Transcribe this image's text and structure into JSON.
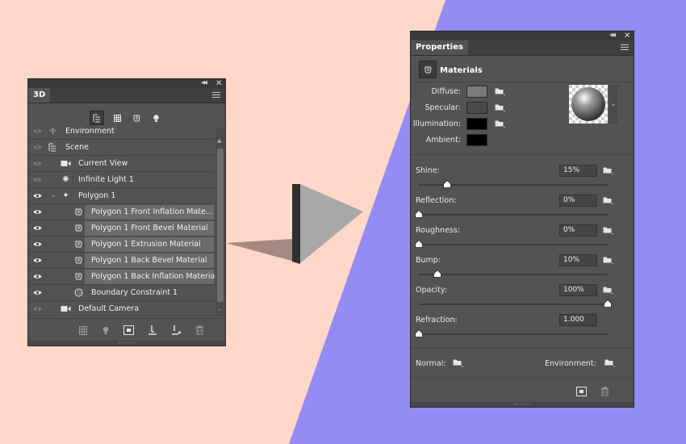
{
  "colors": {
    "bg_left": "#fed7c8",
    "bg_right": "#948cf4",
    "panel": "#535353",
    "panel_dark": "#3f3f3f",
    "selection": "#6b6b6b"
  },
  "panel_3d": {
    "tab": "3D",
    "toolbar_icons": [
      "scene-icon",
      "mesh-icon",
      "material-icon",
      "light-icon"
    ],
    "layers": [
      {
        "label": "Environment",
        "icon": "environment-icon",
        "visible": false,
        "selected": false
      },
      {
        "label": "Scene",
        "icon": "scene-icon",
        "visible": false,
        "selected": false
      },
      {
        "label": "Current View",
        "icon": "camera-icon",
        "visible": false,
        "selected": false
      },
      {
        "label": "Infinite Light 1",
        "icon": "light-icon",
        "visible": true,
        "selected": false
      },
      {
        "label": "Polygon 1",
        "icon": "polygon-icon",
        "visible": true,
        "selected": false
      },
      {
        "label": "Polygon 1 Front Inflation Mate...",
        "icon": "material-icon",
        "visible": true,
        "selected": true
      },
      {
        "label": "Polygon 1 Front Bevel Material",
        "icon": "material-icon",
        "visible": true,
        "selected": true
      },
      {
        "label": "Polygon 1 Extrusion Material",
        "icon": "material-icon",
        "visible": true,
        "selected": true
      },
      {
        "label": "Polygon 1 Back Bevel Material",
        "icon": "material-icon",
        "visible": true,
        "selected": true
      },
      {
        "label": "Polygon 1 Back Inflation Material",
        "icon": "material-icon",
        "visible": true,
        "selected": true
      },
      {
        "label": "Boundary Constraint 1",
        "icon": "constraint-icon",
        "visible": true,
        "selected": false
      },
      {
        "label": "Default Camera",
        "icon": "camera-icon",
        "visible": false,
        "selected": false
      }
    ],
    "bottom_icons": [
      "mesh-icon",
      "light-bulb-icon",
      "render-icon",
      "ground-icon",
      "drop-to-plane-icon",
      "delete-icon"
    ]
  },
  "props": {
    "tab": "Properties",
    "section": "Materials",
    "colors": [
      {
        "label": "Diffuse:",
        "swatch": "#7a7a7a",
        "folder": true
      },
      {
        "label": "Specular:",
        "swatch": "#4a4a4a",
        "folder": true
      },
      {
        "label": "Illumination:",
        "swatch": "#000000",
        "folder": true
      },
      {
        "label": "Ambient:",
        "swatch": "#000000",
        "folder": false
      }
    ],
    "sliders": [
      {
        "label": "Shine:",
        "value": "15%",
        "level": 0.15,
        "folder": true
      },
      {
        "label": "Reflection:",
        "value": "0%",
        "level": 0.0,
        "folder": true
      },
      {
        "label": "Roughness:",
        "value": "0%",
        "level": 0.0,
        "folder": true
      },
      {
        "label": "Bump:",
        "value": "10%",
        "level": 0.1,
        "folder": true
      },
      {
        "label": "Opacity:",
        "value": "100%",
        "level": 1.0,
        "folder": true
      },
      {
        "label": "Refraction:",
        "value": "1.000",
        "level": 0.0,
        "folder": false
      }
    ],
    "normal_label": "Normal:",
    "environment_label": "Environment:"
  }
}
